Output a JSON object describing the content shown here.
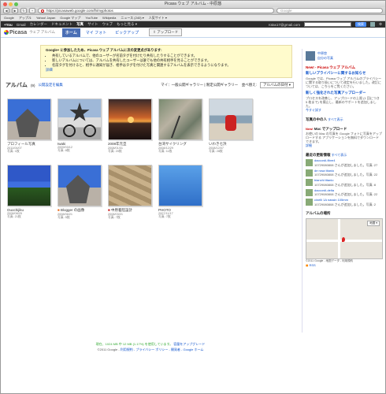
{
  "browser": {
    "window_title": "Picasa ウェブ アルバム - 中原悠",
    "url": "https://picasaweb.google.com/lh/myphotos",
    "search_placeholder": "Google",
    "bookmarks": [
      "Google",
      "アップル",
      "Yahoo! Japan",
      "Google マップ",
      "YouTube",
      "Wikipedia",
      "ニュース (240) ▾",
      "人気サイト ▾"
    ]
  },
  "gbar": {
    "items": [
      "+You",
      "Gmail",
      "カレンダー",
      "ドキュメント",
      "写真",
      "サイト",
      "ウェブ",
      "もっと見る ▾"
    ],
    "search_button": "検索",
    "user": "rotax17@gmail.com",
    "share": "共有"
  },
  "picasa": {
    "logo": "Picasa",
    "logo_sub": "ウェブ アルバム",
    "tabs": [
      "ホーム",
      "マイ フォト",
      "ピックアップ"
    ],
    "upload": "アップロード"
  },
  "notice": {
    "title": "Google+ に参加したため、Picasa ウェブ アルバムに次の変更点があります:",
    "items": [
      "共有しているアルバムで、他のユーザーが名前タグを付けたり共有したりすることができます。",
      "新しいアルバムについては、アルバムを共有したユーザーは誰でも他の共有相手を見ることができます。",
      "名前タグを付けると、相手に通知が届き、相手はタグを付けた写真と関連するアルバムを表示できるようになります。"
    ],
    "details": "詳細"
  },
  "albums_header": {
    "title": "アルバム",
    "count": "(9)",
    "edit_link": "公開設定を編集",
    "sort_label": "マイ：一般公開ギャラリー | 限定公開ギャラリー　並べ替え:",
    "sort_select": "アルバムの日付 ▾"
  },
  "albums": [
    {
      "title": "プロフィール写真",
      "date": "2011/04/07",
      "count": "写真: 1枚"
    },
    {
      "title": "Iwaki",
      "date": "2009/03/12",
      "count": "写真: 8枚"
    },
    {
      "title": "2008年元旦",
      "date": "2008/01/01",
      "count": "写真: 20枚"
    },
    {
      "title": "台湾サイクリング",
      "date": "2008/12/29",
      "count": "写真: 11枚"
    },
    {
      "title": "いわき七浜",
      "date": "2008/12/07",
      "count": "写真: 28枚"
    },
    {
      "title": "Ouochijiku",
      "date": "2008/08/25",
      "count": "写真: 21枚"
    },
    {
      "title": "Blogger の画像",
      "date": "2008/06/21",
      "count": "写真: 5枚"
    },
    {
      "title": "中原着陸設計",
      "date": "2008/03/21",
      "count": "写真: 7枚"
    },
    {
      "title": "PHOTO",
      "date": "2007/11/17",
      "count": "写真: 7枚"
    }
  ],
  "footer": {
    "storage": "現在、1024 MB 中 12 MB (1.17%) を使用しています。",
    "upgrade": "容量をアップグレード",
    "copyright": "©2011 Google",
    "links": "利用規約 - プライバシー ポリシー - 開発者 - Google ホーム"
  },
  "sidebar": {
    "user_name": "中原悠",
    "user_link": "自分の写真",
    "new_title": "New! - Picasa ウェブ アルバム",
    "privacy_link": "新しいプライバシーに関するお知らせ",
    "privacy_text": "Google では、Picasa ウェブ アルバムのプライバシーに関する取り扱いについて改定を行いました。改訂については、こちらをご覧ください。",
    "update_link": "新しく強化された写真アップローダー",
    "update_text": "プロセスを改善し、アップロードの上限 (1 回につき 5 枚まで) を廃止し、最新のサポートを追加しました。",
    "update_more": "今すぐ試す",
    "people_title": "写真の中の人",
    "people_link": "すべて表示",
    "mac_title": "Mac でアップロード",
    "mac_new": "New!",
    "mac_text": "お使いの Mac の写真を Google フォトに写真をアップロードする アプリケーションを無料でダウンロードできます。",
    "mac_link": "詳細",
    "activity_title": "最近の更新情報",
    "activity_link": "すべて表示",
    "activities": [
      {
        "name": "daccordi-fibre4",
        "text": "10729080808 さんが追加しました。写真: 27"
      },
      {
        "name": "de rosa titanio",
        "text": "10729080808 さんが追加しました。写真: 22"
      },
      {
        "name": "bianchi titanio",
        "text": "10729080808 さんが追加しました。写真: 8"
      },
      {
        "name": "daccordi-delta",
        "text": "10729080808 さんが追加しました。写真: 22"
      },
      {
        "name": "cinelli 1A nassin 105mm",
        "text": "10729080808 さんが追加しました。写真: 2"
      }
    ],
    "map_title": "アルバムの場所",
    "map_select": "地図 ▾",
    "map_copy": "©2011 Google - 地図データ - 利用規約",
    "rss": "RSS"
  },
  "colors": {
    "accent": "#4a6fb5",
    "link": "#1155cc",
    "notice_bg": "#fffbcc",
    "gbar": "#2d2d2d"
  }
}
